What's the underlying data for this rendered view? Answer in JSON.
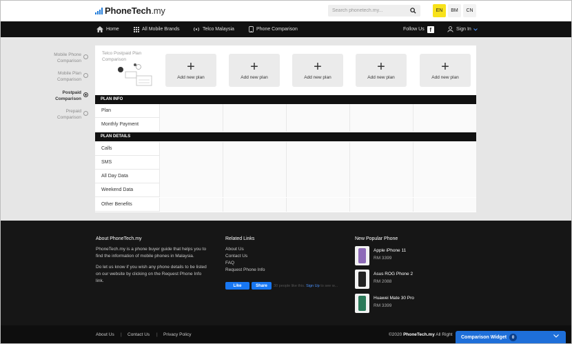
{
  "brand": {
    "name_bold": "PhoneTech",
    "name_rest": ".my",
    "accent": "#1e7ad9"
  },
  "search": {
    "placeholder": "Search phonetech.my..."
  },
  "languages": [
    {
      "label": "EN",
      "active": true
    },
    {
      "label": "BM",
      "active": false
    },
    {
      "label": "CN",
      "active": false
    }
  ],
  "nav": {
    "home": "Home",
    "brands": "All Mobile Brands",
    "telco": "Telco Malaysia",
    "comparison": "Phone Comparison",
    "follow": "Follow Us",
    "signin": "Sign In"
  },
  "sidebar": {
    "items": [
      {
        "line1": "Mobile Phone",
        "line2": "Comparison"
      },
      {
        "line1": "Mobile Plan",
        "line2": "Comparison"
      },
      {
        "line1": "Postpaid",
        "line2": "Comparison"
      },
      {
        "line1": "Prepaid",
        "line2": "Comparison"
      }
    ]
  },
  "main": {
    "title": "Telco Postpaid Plan Comparison",
    "add_plan_label": "Add new plan",
    "plan_slots": 5,
    "sections": [
      {
        "header": "PLAN INFO",
        "rows": [
          "Plan",
          "Monthly Payment"
        ]
      },
      {
        "header": "PLAN DETAILS",
        "rows": [
          "Calls",
          "SMS",
          "All Day Data",
          "Weekend Data",
          "Other Benefits"
        ]
      }
    ]
  },
  "footer": {
    "about_heading": "About PhoneTech.my",
    "about_p1_l1": "PhoneTech.my is a phone buyer guide that helps you to",
    "about_p1_l2": "find the information of mobile phones in Malaysia.",
    "about_p2_l1": "Do let us know if you wish any phone details to be listed",
    "about_p2_l2": "on our website by clicking on the Request Phone Info",
    "about_p2_l3": "link.",
    "related_heading": "Related Links",
    "related_links": [
      "About Us",
      "Contact Us",
      "FAQ",
      "Request Phone Info"
    ],
    "fb_like": "Like",
    "fb_share": "Share",
    "fb_note_a": "30 people like this.",
    "fb_note_link": "Sign Up",
    "fb_note_b": "to see w...",
    "popular_heading": "New Popular Phone",
    "phones": [
      {
        "name": "Apple iPhone 11",
        "price": "RM 3399",
        "color": "#8e6bb8"
      },
      {
        "name": "Asus ROG Phone 2",
        "price": "RM 2088",
        "color": "#222222"
      },
      {
        "name": "Huawei Mate 30 Pro",
        "price": "RM 3399",
        "color": "#2c7a5a"
      }
    ]
  },
  "bottom": {
    "links": [
      "About Us",
      "Contact Us",
      "Privacy Policy"
    ],
    "separator": "|",
    "copy_pre": "©2020",
    "copy_brand": "PhoneTech.my",
    "copy_post": "All Right"
  },
  "widget": {
    "label": "Comparison Widget",
    "count": "0"
  }
}
